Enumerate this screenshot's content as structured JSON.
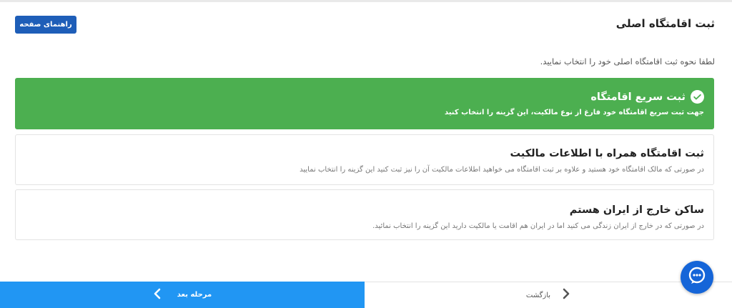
{
  "header": {
    "title": "ثبت اقامتگاه اصلی",
    "guide_button": "راهنمای صفحه"
  },
  "instruction": "لطفا نحوه ثبت اقامتگاه اصلی خود را انتخاب نمایید.",
  "options": [
    {
      "title": "ثبت سریع اقامتگاه",
      "description": "جهت ثبت سریع اقامتگاه خود فارغ از نوع مالکیت، این گزینه را انتخاب کنید",
      "selected": true
    },
    {
      "title": "ثبت اقامتگاه همراه با اطلاعات مالکیت",
      "description": "در صورتی که مالک اقامتگاه خود هستید و علاوه بر ثبت اقامتگاه می خواهید اطلاعات مالکیت آن را نیز ثبت کنید این گزینه را انتخاب نمایید",
      "selected": false
    },
    {
      "title": "ساکن خارج از ایران هستم",
      "description": "در صورتی که در خارج از ایران زندگی می کنید اما در ایران هم اقامت یا مالکیت دارید این گزینه را انتخاب نمائید.",
      "selected": false
    }
  ],
  "footer": {
    "next_label": "مرحله بعد",
    "back_label": "بازگشت"
  },
  "icons": {
    "selected_check": "check-circle-icon",
    "next": "chevron-left-icon",
    "back": "chevron-right-icon",
    "chat": "chat-bubble-icon"
  },
  "colors": {
    "primary_blue": "#1e5eb8",
    "footer_blue": "#2196f3",
    "selected_green": "#4caf50",
    "chat_blue": "#1565d8"
  }
}
